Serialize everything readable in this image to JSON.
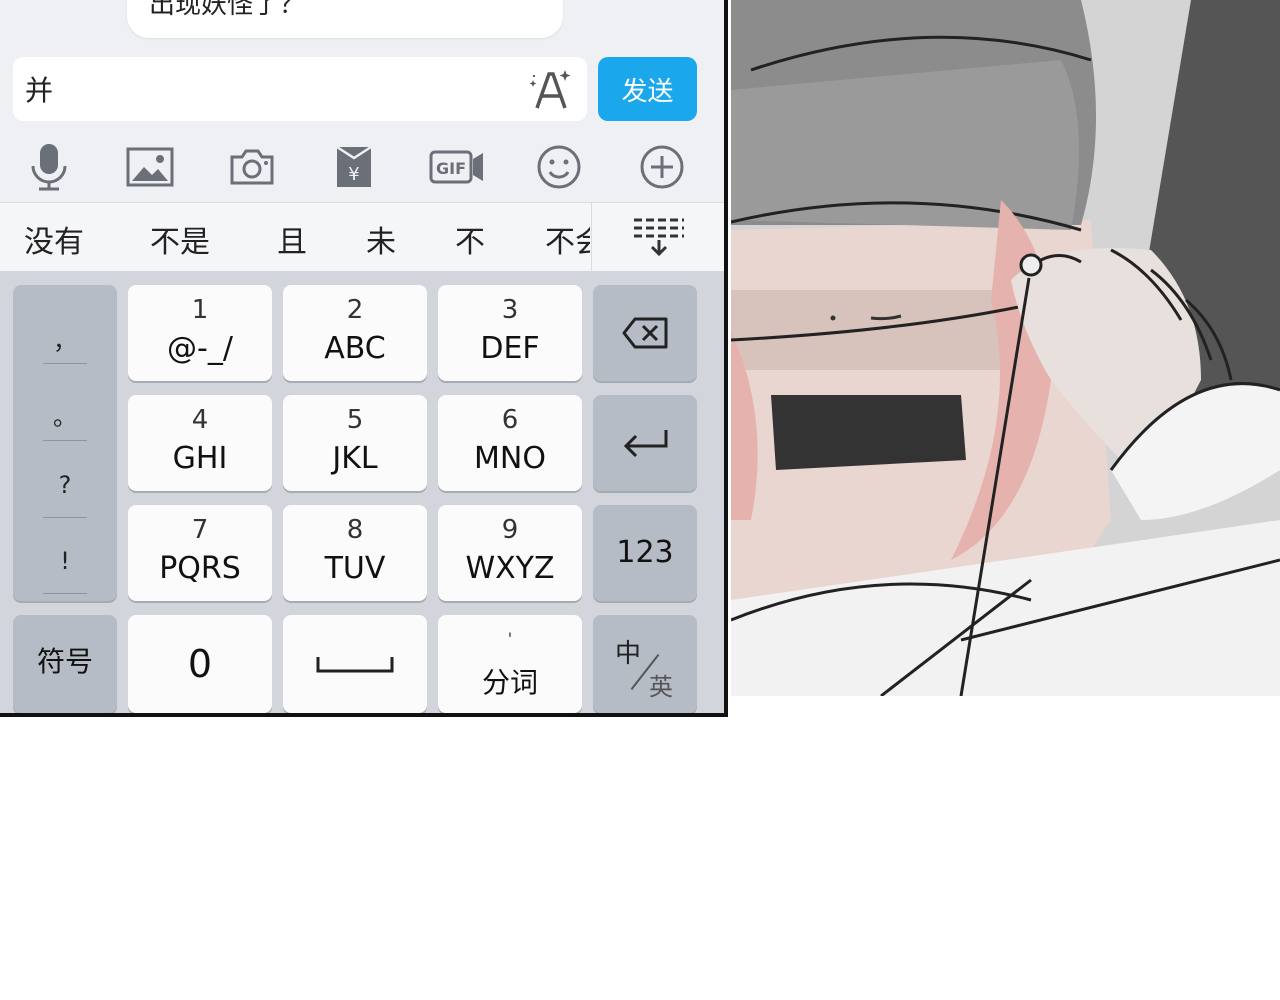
{
  "chat": {
    "bubble_text": "出现妖怪了？"
  },
  "input": {
    "value": "并",
    "send_label": "发送"
  },
  "toolbar_icons": [
    "microphone-icon",
    "image-icon",
    "camera-icon",
    "red-envelope-icon",
    "gif-icon",
    "emoji-icon",
    "plus-icon"
  ],
  "candidates": [
    "没有",
    "不是",
    "且",
    "未",
    "不",
    "不会"
  ],
  "keyboard": {
    "punctuation": [
      "，",
      "。",
      "?",
      "!"
    ],
    "keys": [
      {
        "num": "1",
        "letters": "@-_/"
      },
      {
        "num": "2",
        "letters": "ABC"
      },
      {
        "num": "3",
        "letters": "DEF"
      },
      {
        "num": "4",
        "letters": "GHI"
      },
      {
        "num": "5",
        "letters": "JKL"
      },
      {
        "num": "6",
        "letters": "MNO"
      },
      {
        "num": "7",
        "letters": "PQRS"
      },
      {
        "num": "8",
        "letters": "TUV"
      },
      {
        "num": "9",
        "letters": "WXYZ"
      }
    ],
    "numbers_label": "123",
    "symbols_label": "符号",
    "zero_label": "0",
    "segment_label": "分词",
    "lang_zh": "中",
    "lang_en": "英"
  },
  "colors": {
    "send": "#1aa7ec",
    "keyboard_bg": "#d2d6dc",
    "function_key": "#b6bcc5"
  }
}
